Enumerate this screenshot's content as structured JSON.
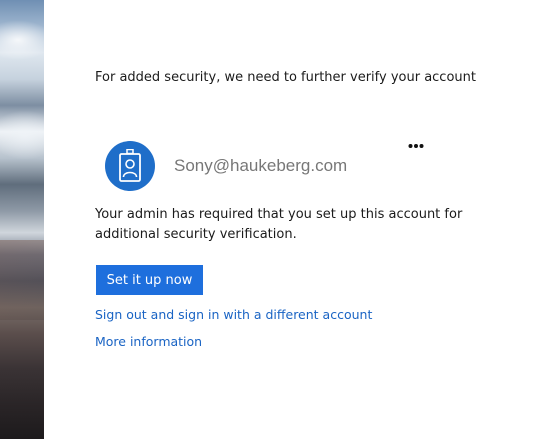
{
  "header": {
    "heading": "For added security, we need to further verify your account"
  },
  "account": {
    "email": "Sony@haukeberg.com",
    "avatar_icon": "user-badge-icon",
    "more_icon": "ellipsis-icon",
    "accent_color": "#1f6ec9"
  },
  "message": {
    "text": "Your admin has required that you set up this account for additional security verification."
  },
  "actions": {
    "setup_label": "Set it up now",
    "signout_label": "Sign out and sign in with a different account",
    "more_info_label": "More information",
    "button_color": "#1e6fdd",
    "link_color": "#1a64c4"
  }
}
